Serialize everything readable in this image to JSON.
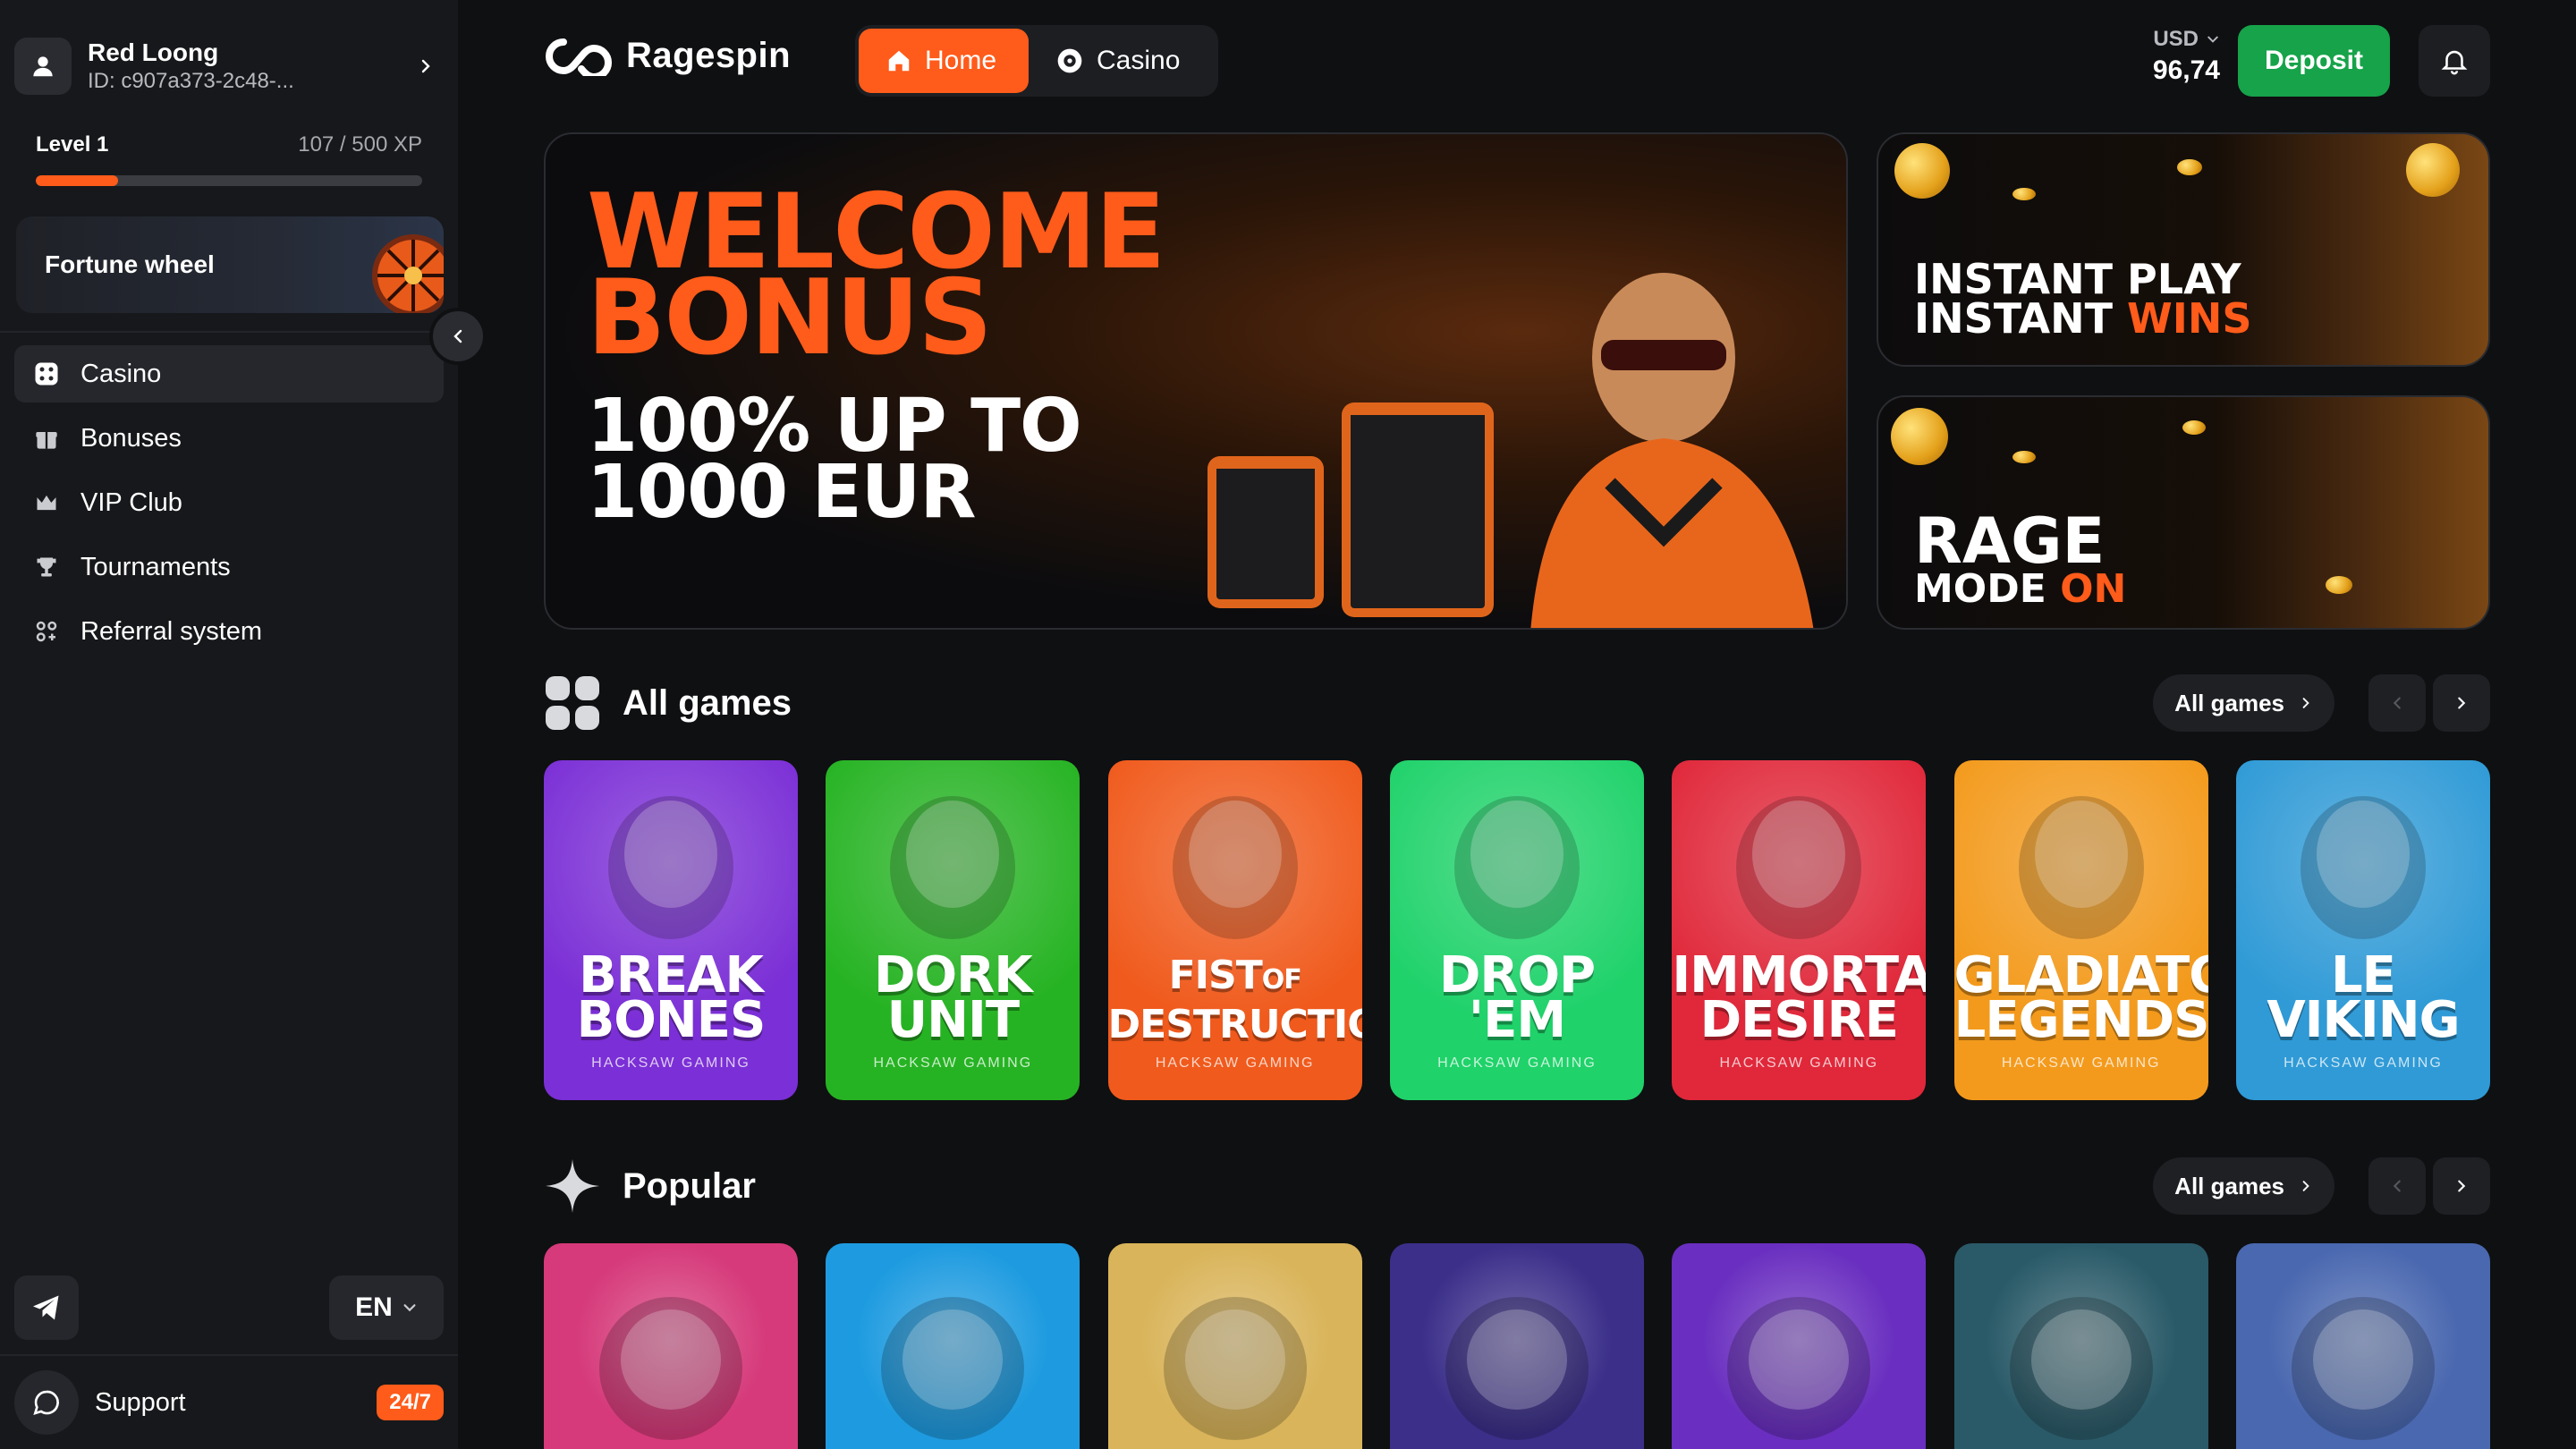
{
  "user": {
    "name": "Red Loong",
    "id": "ID: c907a373-2c48-..."
  },
  "level": {
    "label": "Level 1",
    "xp_text": "107 / 500 XP",
    "progress": 0.214
  },
  "fortune": {
    "label": "Fortune wheel"
  },
  "nav": [
    {
      "label": "Casino",
      "icon": "dice-icon",
      "active": true
    },
    {
      "label": "Bonuses",
      "icon": "gift-icon"
    },
    {
      "label": "VIP Club",
      "icon": "crown-icon"
    },
    {
      "label": "Tournaments",
      "icon": "trophy-icon"
    },
    {
      "label": "Referral system",
      "icon": "users-icon"
    }
  ],
  "language": "EN",
  "support": {
    "label": "Support",
    "badge": "24/7"
  },
  "header": {
    "logo": "Ragespin",
    "tabs": [
      {
        "label": "Home",
        "active": true
      },
      {
        "label": "Casino"
      }
    ],
    "currency": "USD",
    "balance": "96,74",
    "deposit": "Deposit"
  },
  "hero": {
    "line1a": "WELCOME",
    "line1b": "BONUS",
    "line2a": "100% UP TO",
    "line2b": "1000 EUR"
  },
  "banners": {
    "b1": {
      "line1": "INSTANT PLAY",
      "line2a": "INSTANT ",
      "line2b": "WINS"
    },
    "b2": {
      "line1": "RAGE",
      "line2a": "MODE ",
      "line2b": "ON"
    }
  },
  "sections": {
    "all_games": {
      "title": "All games",
      "button": "All games"
    },
    "popular": {
      "title": "Popular",
      "button": "All games"
    }
  },
  "games": [
    {
      "line1": "BREAK",
      "line2": "BONES",
      "provider": "HACKSAW GAMING",
      "color": "#7b2fd6"
    },
    {
      "line1": "DORK",
      "line2": "UNIT",
      "provider": "HACKSAW GAMING",
      "color": "#26b323"
    },
    {
      "line1": "FIST",
      "line2": "DESTRUCTION",
      "suffix": "OF",
      "provider": "HACKSAW GAMING",
      "color": "#f05a1c"
    },
    {
      "line1": "DROP",
      "line2": "'EM",
      "provider": "HACKSAW GAMING",
      "color": "#1fd26a"
    },
    {
      "line1": "IMMORTAL",
      "line2": "DESIRE",
      "provider": "HACKSAW GAMING",
      "color": "#e0283a"
    },
    {
      "line1": "GLADIATOR",
      "line2": "LEGENDS",
      "provider": "HACKSAW GAMING",
      "color": "#f39a1c"
    },
    {
      "line1": "LE",
      "line2": "VIKING",
      "provider": "HACKSAW GAMING",
      "color": "#2f9ad6"
    }
  ],
  "popular": [
    {
      "color": "#d63a7a"
    },
    {
      "color": "#1e9be0"
    },
    {
      "color": "#d9b45a"
    },
    {
      "color": "#3b2f8a"
    },
    {
      "color": "#6a2fc0"
    },
    {
      "color": "#2a5a68"
    },
    {
      "color": "#4a68b0"
    }
  ]
}
